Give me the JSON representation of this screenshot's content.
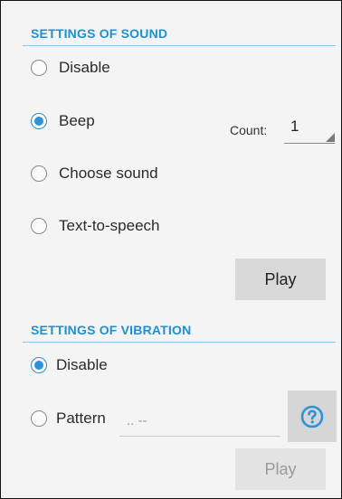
{
  "sound": {
    "title": "SETTINGS OF SOUND",
    "options": [
      {
        "label": "Disable",
        "checked": false
      },
      {
        "label": "Beep",
        "checked": true
      },
      {
        "label": "Choose sound",
        "checked": false
      },
      {
        "label": "Text-to-speech",
        "checked": false
      }
    ],
    "count_label": "Count:",
    "count_value": "1",
    "play_label": "Play"
  },
  "vibration": {
    "title": "SETTINGS OF VIBRATION",
    "options": [
      {
        "label": "Disable",
        "checked": true
      },
      {
        "label": "Pattern",
        "checked": false
      }
    ],
    "pattern_placeholder": ".. --",
    "help_icon": "question-circle-icon",
    "play_label": "Play",
    "play_disabled": true
  },
  "colors": {
    "accent": "#1e90d6",
    "button_bg": "#d9d9d9",
    "help_icon": "#2c93d8"
  }
}
